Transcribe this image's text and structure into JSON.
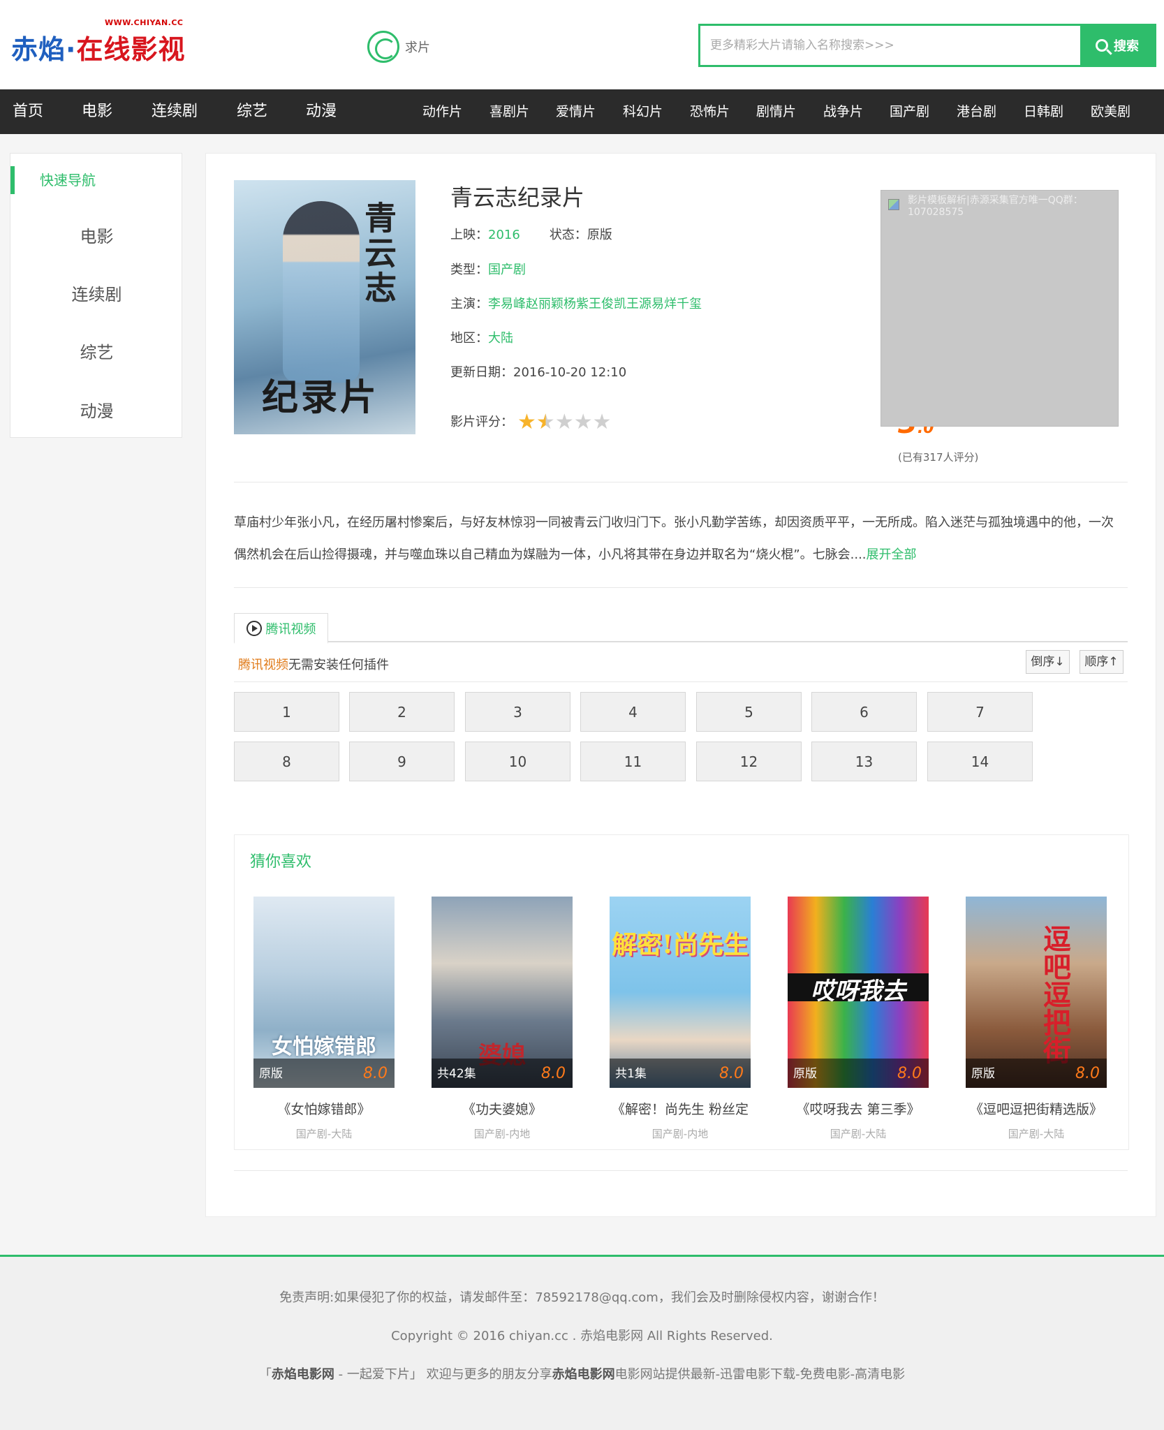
{
  "header": {
    "logo_url": "WWW.CHIYAN.CC",
    "logo_part1": "赤焰·",
    "logo_part2": "在线影视",
    "request_label": "求片",
    "search_placeholder": "更多精彩大片请输入名称搜索>>>",
    "search_button": "搜索"
  },
  "nav": {
    "main": [
      "首页",
      "电影",
      "连续剧",
      "综艺",
      "动漫"
    ],
    "sub": [
      "动作片",
      "喜剧片",
      "爱情片",
      "科幻片",
      "恐怖片",
      "剧情片",
      "战争片",
      "国产剧",
      "港台剧",
      "日韩剧",
      "欧美剧"
    ]
  },
  "sidebar": {
    "title": "快速导航",
    "items": [
      "电影",
      "连续剧",
      "综艺",
      "动漫"
    ]
  },
  "movie": {
    "poster_title_top": "青云志",
    "poster_title_bottom": "纪录片",
    "title": "青云志纪录片",
    "release_label": "上映：",
    "release": "2016",
    "status_label": "状态：",
    "status": "原版",
    "type_label": "类型：",
    "type": "国产剧",
    "cast_label": "主演：",
    "cast": "李易峰赵丽颖杨紫王俊凯王源易烊千玺",
    "region_label": "地区：",
    "region": "大陆",
    "updated_label": "更新日期：",
    "updated": "2016-10-20 12:10",
    "rating_label": "影片评分：",
    "rating_stars": 1.5,
    "rating_max": 5,
    "score_int": "3",
    "score_dec": ".0",
    "rating_count": "(已有317人评分)",
    "ad_text": "影片模板解析|赤源采集官方唯一QQ群：107028575",
    "synopsis": "草庙村少年张小凡，在经历屠村惨案后，与好友林惊羽一同被青云门收归门下。张小凡勤学苦练，却因资质平平，一无所成。陷入迷茫与孤独境遇中的他，一次偶然机会在后山捡得摄魂，并与噬血珠以自己精血为媒融为一体，小凡将其带在身边并取名为“烧火棍”。七脉会....",
    "synopsis_more": "展开全部"
  },
  "player": {
    "tab_label": "腾讯视频",
    "source_name": "腾讯视频",
    "source_note": "无需安装任何插件",
    "order_desc": "倒序↓",
    "order_asc": "顺序↑",
    "episodes": [
      "1",
      "2",
      "3",
      "4",
      "5",
      "6",
      "7",
      "8",
      "9",
      "10",
      "11",
      "12",
      "13",
      "14"
    ]
  },
  "recommend": {
    "title": "猜你喜欢",
    "items": [
      {
        "name": "《女怕嫁错郎》",
        "badge": "原版",
        "score": "8.0",
        "meta": "国产剧-大陆",
        "art": "女怕嫁错郎"
      },
      {
        "name": "《功夫婆媳》",
        "badge": "共42集",
        "score": "8.0",
        "meta": "国产剧-内地",
        "art": "婆媳"
      },
      {
        "name": "《解密！尚先生 粉丝定",
        "badge": "共1集",
        "score": "8.0",
        "meta": "国产剧-内地",
        "art": "解密!尚先生"
      },
      {
        "name": "《哎呀我去 第三季》",
        "badge": "原版",
        "score": "8.0",
        "meta": "国产剧-大陆",
        "art": "哎呀我去"
      },
      {
        "name": "《逗吧逗把街精选版》",
        "badge": "原版",
        "score": "8.0",
        "meta": "国产剧-大陆",
        "art": "逗吧逗把街"
      }
    ]
  },
  "footer": {
    "disclaimer": "免责声明:如果侵犯了你的权益，请发邮件至：78592178@qq.com，我们会及时删除侵权内容，谢谢合作！",
    "copyright": "Copyright © 2016 chiyan.cc . 赤焰电影网 All Rights Reserved.",
    "slogan_prefix": "「",
    "slogan_site": "赤焰电影网",
    "slogan_mid": " - 一起爱下片」  欢迎与更多的朋友分享",
    "slogan_site2": "赤焰电影网",
    "slogan_tail": "电影网站提供最新-迅雷电影下载-免费电影-高清电影"
  },
  "colors": {
    "accent": "#2ebd6b",
    "nav_bg": "#2b2b2b",
    "logo_blue": "#1f5fbf",
    "logo_red": "#d8161e",
    "score": "#ff6a00"
  }
}
